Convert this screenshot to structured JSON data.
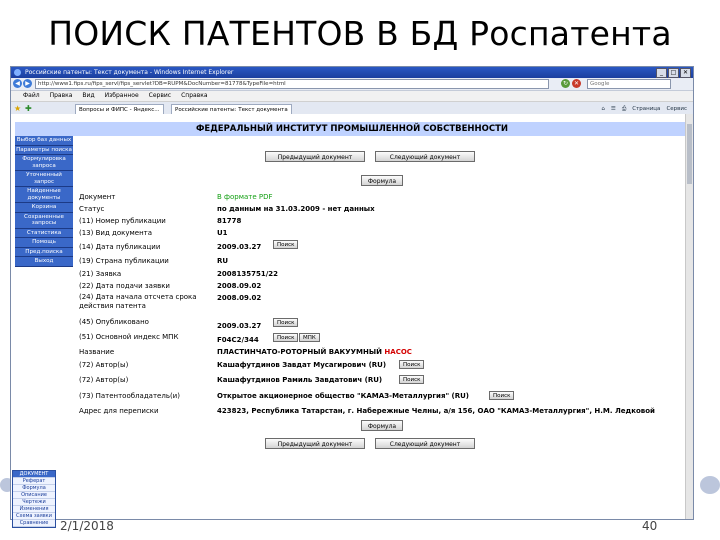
{
  "slide": {
    "title": "ПОИСК ПАТЕНТОВ В БД Роспатента",
    "date": "2/1/2018",
    "page_number": "40"
  },
  "browser": {
    "window_title": "Российские патенты: Текст документа - Windows Internet Explorer",
    "url": "http://www1.fips.ru/fips_servl/fips_servlet?DB=RUPM&DocNumber=81778&TypeFile=html",
    "search_placeholder": "Google",
    "menu": [
      "Файл",
      "Правка",
      "Вид",
      "Избранное",
      "Сервис",
      "Справка"
    ],
    "tab_label": "Российские патенты: Текст документа",
    "tab_label_2": "Вопросы и ФИПС - Яндекс...",
    "tab_tools": [
      "Страница",
      "Сервис"
    ]
  },
  "page": {
    "header": "ФЕДЕРАЛЬНЫЙ ИНСТИТУТ ПРОМЫШЛЕННОЙ СОБСТВЕННОСТИ",
    "prev_doc_label": "Предыдущий документ",
    "next_doc_label": "Следующий документ",
    "formula_label": "Формула",
    "search_btn": "Поиск",
    "mpk_btn": "МПК"
  },
  "sidebar": {
    "items": [
      {
        "label": "Выбор баз данных"
      },
      {
        "label": "Параметры поиска"
      },
      {
        "label": "Формулировка запроса"
      },
      {
        "label": "Уточненный запрос"
      },
      {
        "label": "Найденные документы"
      },
      {
        "label": "Корзина"
      },
      {
        "label": "Сохраненные запросы"
      },
      {
        "label": "Статистика"
      },
      {
        "label": "Помощь"
      },
      {
        "label": "Пред.поиска"
      },
      {
        "label": "Выход"
      }
    ]
  },
  "doc_fields": [
    {
      "label": "Документ",
      "value": "В формате PDF"
    },
    {
      "label": "Статус",
      "value": "по данным на 31.03.2009 - нет данных"
    },
    {
      "label": "(11) Номер публикации",
      "value": "81778"
    },
    {
      "label": "(13) Вид документа",
      "value": "U1"
    },
    {
      "label": "(14) Дата публикации",
      "value": "2009.03.27"
    },
    {
      "label": "(19) Страна публикации",
      "value": "RU"
    },
    {
      "label": "(21) Заявка",
      "value": "2008135751/22"
    },
    {
      "label": "(22) Дата подачи заявки",
      "value": "2008.09.02"
    },
    {
      "label": "(24) Дата начала отсчета срока действия патента",
      "value": "2008.09.02"
    },
    {
      "label": "(45) Опубликовано",
      "value": "2009.03.27"
    },
    {
      "label": "(51) Основной индекс МПК",
      "value": "F04C2/344"
    },
    {
      "label": "Название",
      "value": "ПЛАСТИНЧАТО-РОТОРНЫЙ ВАКУУМНЫЙ",
      "value_red": "НАСОС"
    },
    {
      "label": "(72) Автор(ы)",
      "value": "Кашафутдинов Завдат Мусагирович (RU)"
    },
    {
      "label": "(72) Автор(ы)",
      "value": "Кашафутдинов Рамиль Завдатович (RU)"
    },
    {
      "label": "(73) Патентообладатель(и)",
      "value": "Открытое акционерное общество \"КАМАЗ-Металлургия\" (RU)"
    },
    {
      "label": "Адрес для переписки",
      "value": "423823, Республика Татарстан, г. Набережные Челны, а/я 156, ОАО \"КАМАЗ-Металлургия\", Н.М. Ледковой"
    }
  ],
  "doc_links": [
    "ДОКУМЕНТ",
    "Реферат",
    "Формула",
    "Описание",
    "Чертежи",
    "Изменения",
    "Схема заявки",
    "Сравнение"
  ]
}
